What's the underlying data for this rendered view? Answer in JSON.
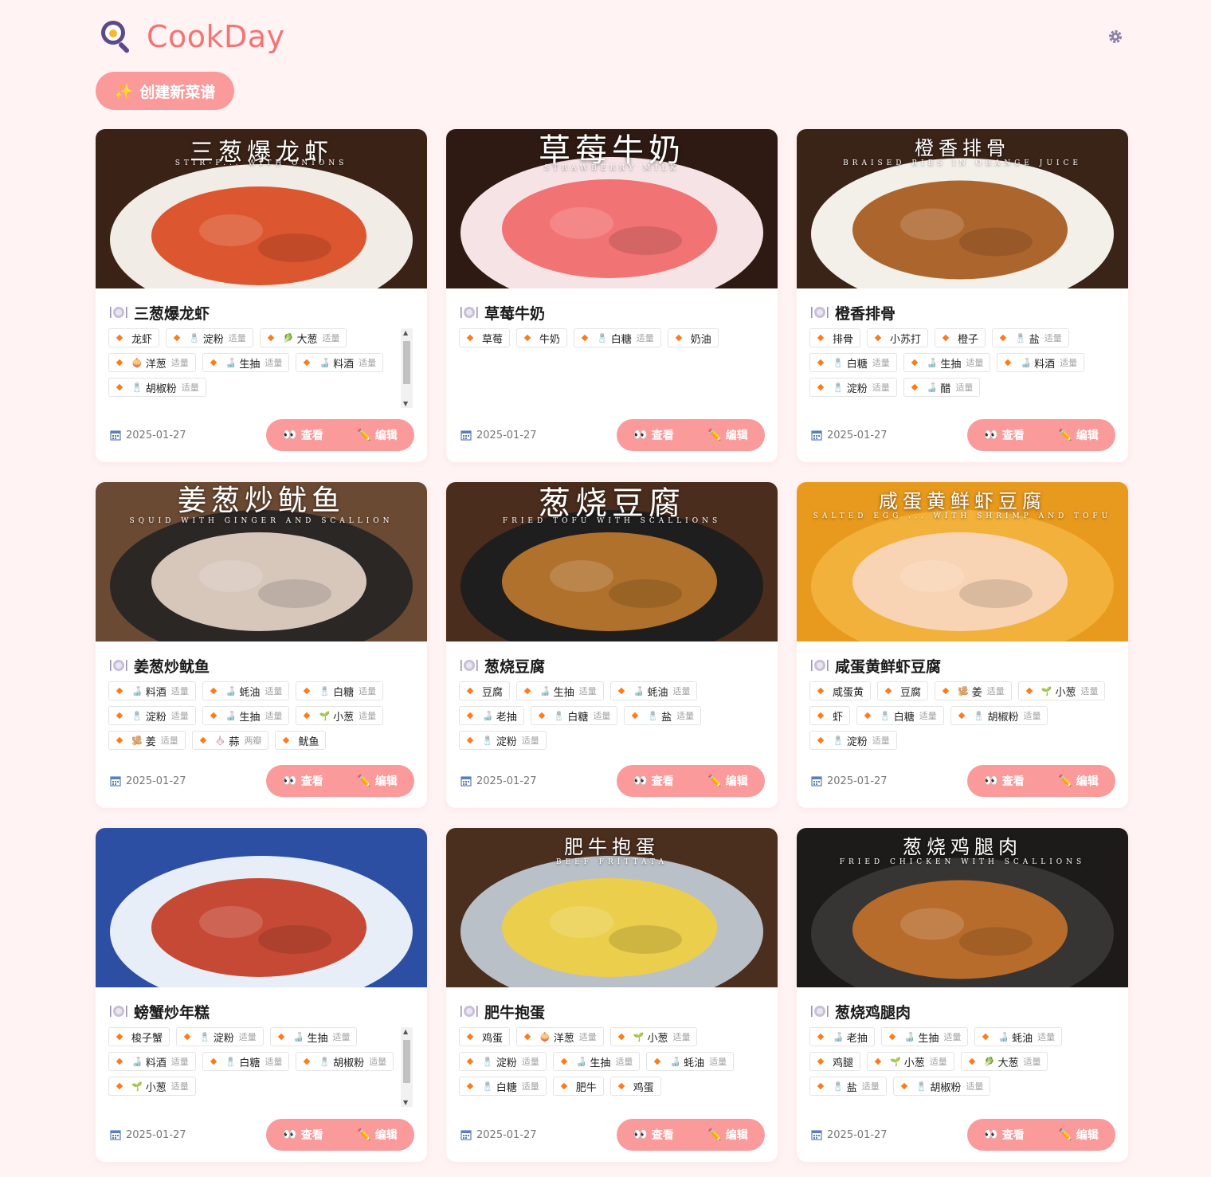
{
  "app": {
    "title": "CookDay",
    "create_label": "创建新菜谱",
    "create_icon": "✨"
  },
  "colors": {
    "accent": "#fa9a9a",
    "brand": "#f47474",
    "background": "#fff3f3",
    "dot": "#ff7a1a"
  },
  "common": {
    "view_label": "查看",
    "edit_label": "编辑",
    "view_icon": "👀",
    "edit_icon": "✏️"
  },
  "recipes": [
    {
      "name": "三葱爆龙虾",
      "image_title": "三葱爆龙虾",
      "image_subtitle": "Stir-F... With Onions",
      "date": "2025-01-27",
      "ingredients": [
        {
          "icon": "",
          "name": "龙虾",
          "amount": ""
        },
        {
          "icon": "🧂",
          "name": "淀粉",
          "amount": "适量"
        },
        {
          "icon": "🥬",
          "name": "大葱",
          "amount": "适量"
        },
        {
          "icon": "🧅",
          "name": "洋葱",
          "amount": "适量"
        },
        {
          "icon": "🍶",
          "name": "生抽",
          "amount": "适量"
        },
        {
          "icon": "🍶",
          "name": "料酒",
          "amount": "适量"
        },
        {
          "icon": "🧂",
          "name": "胡椒粉",
          "amount": "适量"
        }
      ]
    },
    {
      "name": "草莓牛奶",
      "image_title": "草莓牛奶",
      "image_subtitle": "Strawberry Milk",
      "date": "2025-01-27",
      "ingredients": [
        {
          "icon": "",
          "name": "草莓",
          "amount": ""
        },
        {
          "icon": "",
          "name": "牛奶",
          "amount": ""
        },
        {
          "icon": "🧂",
          "name": "白糖",
          "amount": "适量"
        },
        {
          "icon": "",
          "name": "奶油",
          "amount": ""
        }
      ]
    },
    {
      "name": "橙香排骨",
      "image_title": "橙香排骨",
      "image_subtitle": "Braised Ribs in Orange Juice",
      "date": "2025-01-27",
      "ingredients": [
        {
          "icon": "",
          "name": "排骨",
          "amount": ""
        },
        {
          "icon": "",
          "name": "小苏打",
          "amount": ""
        },
        {
          "icon": "",
          "name": "橙子",
          "amount": ""
        },
        {
          "icon": "🧂",
          "name": "盐",
          "amount": "适量"
        },
        {
          "icon": "🧂",
          "name": "白糖",
          "amount": "适量"
        },
        {
          "icon": "🍶",
          "name": "生抽",
          "amount": "适量"
        },
        {
          "icon": "🍶",
          "name": "料酒",
          "amount": "适量"
        },
        {
          "icon": "🧂",
          "name": "淀粉",
          "amount": "适量"
        },
        {
          "icon": "🍶",
          "name": "醋",
          "amount": "适量"
        }
      ]
    },
    {
      "name": "姜葱炒鱿鱼",
      "image_title": "姜葱炒鱿鱼",
      "image_subtitle": "Squid With Ginger And Scallion",
      "date": "2025-01-27",
      "ingredients": [
        {
          "icon": "🍶",
          "name": "料酒",
          "amount": "适量"
        },
        {
          "icon": "🍶",
          "name": "蚝油",
          "amount": "适量"
        },
        {
          "icon": "🧂",
          "name": "白糖",
          "amount": "适量"
        },
        {
          "icon": "🧂",
          "name": "淀粉",
          "amount": "适量"
        },
        {
          "icon": "🍶",
          "name": "生抽",
          "amount": "适量"
        },
        {
          "icon": "🌱",
          "name": "小葱",
          "amount": "适量"
        },
        {
          "icon": "🫚",
          "name": "姜",
          "amount": "适量"
        },
        {
          "icon": "🧄",
          "name": "蒜",
          "amount": "两瓣"
        },
        {
          "icon": "",
          "name": "鱿鱼",
          "amount": ""
        }
      ]
    },
    {
      "name": "葱烧豆腐",
      "image_title": "葱烧豆腐",
      "image_subtitle": "Fried Tofu With Scallions",
      "date": "2025-01-27",
      "ingredients": [
        {
          "icon": "",
          "name": "豆腐",
          "amount": ""
        },
        {
          "icon": "🍶",
          "name": "生抽",
          "amount": "适量"
        },
        {
          "icon": "🍶",
          "name": "蚝油",
          "amount": "适量"
        },
        {
          "icon": "🍶",
          "name": "老抽",
          "amount": ""
        },
        {
          "icon": "🧂",
          "name": "白糖",
          "amount": "适量"
        },
        {
          "icon": "🧂",
          "name": "盐",
          "amount": "适量"
        },
        {
          "icon": "🧂",
          "name": "淀粉",
          "amount": "适量"
        }
      ]
    },
    {
      "name": "咸蛋黄鲜虾豆腐",
      "image_title": "咸蛋黄鲜虾豆腐",
      "image_subtitle": "Salted Egg ... With Shrimp And Tofu",
      "date": "2025-01-27",
      "ingredients": [
        {
          "icon": "",
          "name": "咸蛋黄",
          "amount": ""
        },
        {
          "icon": "",
          "name": "豆腐",
          "amount": ""
        },
        {
          "icon": "🫚",
          "name": "姜",
          "amount": "适量"
        },
        {
          "icon": "🌱",
          "name": "小葱",
          "amount": "适量"
        },
        {
          "icon": "",
          "name": "虾",
          "amount": ""
        },
        {
          "icon": "🧂",
          "name": "白糖",
          "amount": "适量"
        },
        {
          "icon": "🧂",
          "name": "胡椒粉",
          "amount": "适量"
        },
        {
          "icon": "🧂",
          "name": "淀粉",
          "amount": "适量"
        }
      ]
    },
    {
      "name": "螃蟹炒年糕",
      "image_title": "",
      "image_subtitle": "",
      "date": "2025-01-27",
      "ingredients": [
        {
          "icon": "",
          "name": "梭子蟹",
          "amount": ""
        },
        {
          "icon": "🧂",
          "name": "淀粉",
          "amount": "适量"
        },
        {
          "icon": "🍶",
          "name": "生抽",
          "amount": "适量"
        },
        {
          "icon": "🍶",
          "name": "料酒",
          "amount": "适量"
        },
        {
          "icon": "🧂",
          "name": "白糖",
          "amount": "适量"
        },
        {
          "icon": "🧂",
          "name": "胡椒粉",
          "amount": "适量"
        },
        {
          "icon": "🌱",
          "name": "小葱",
          "amount": "适量"
        }
      ]
    },
    {
      "name": "肥牛抱蛋",
      "image_title": "肥牛抱蛋",
      "image_subtitle": "Beef Frittata",
      "date": "2025-01-27",
      "ingredients": [
        {
          "icon": "",
          "name": "鸡蛋",
          "amount": ""
        },
        {
          "icon": "🧅",
          "name": "洋葱",
          "amount": "适量"
        },
        {
          "icon": "🌱",
          "name": "小葱",
          "amount": "适量"
        },
        {
          "icon": "🧂",
          "name": "淀粉",
          "amount": "适量"
        },
        {
          "icon": "🍶",
          "name": "生抽",
          "amount": "适量"
        },
        {
          "icon": "🍶",
          "name": "蚝油",
          "amount": "适量"
        },
        {
          "icon": "🧂",
          "name": "白糖",
          "amount": "适量"
        },
        {
          "icon": "",
          "name": "肥牛",
          "amount": ""
        },
        {
          "icon": "",
          "name": "鸡蛋",
          "amount": ""
        }
      ]
    },
    {
      "name": "葱烧鸡腿肉",
      "image_title": "葱烧鸡腿肉",
      "image_subtitle": "Fried Chicken With Scallions",
      "date": "2025-01-27",
      "ingredients": [
        {
          "icon": "🍶",
          "name": "老抽",
          "amount": ""
        },
        {
          "icon": "🍶",
          "name": "生抽",
          "amount": "适量"
        },
        {
          "icon": "🍶",
          "name": "蚝油",
          "amount": "适量"
        },
        {
          "icon": "",
          "name": "鸡腿",
          "amount": ""
        },
        {
          "icon": "🌱",
          "name": "小葱",
          "amount": "适量"
        },
        {
          "icon": "🥬",
          "name": "大葱",
          "amount": "适量"
        },
        {
          "icon": "🧂",
          "name": "盐",
          "amount": "适量"
        },
        {
          "icon": "🧂",
          "name": "胡椒粉",
          "amount": "适量"
        }
      ]
    }
  ]
}
